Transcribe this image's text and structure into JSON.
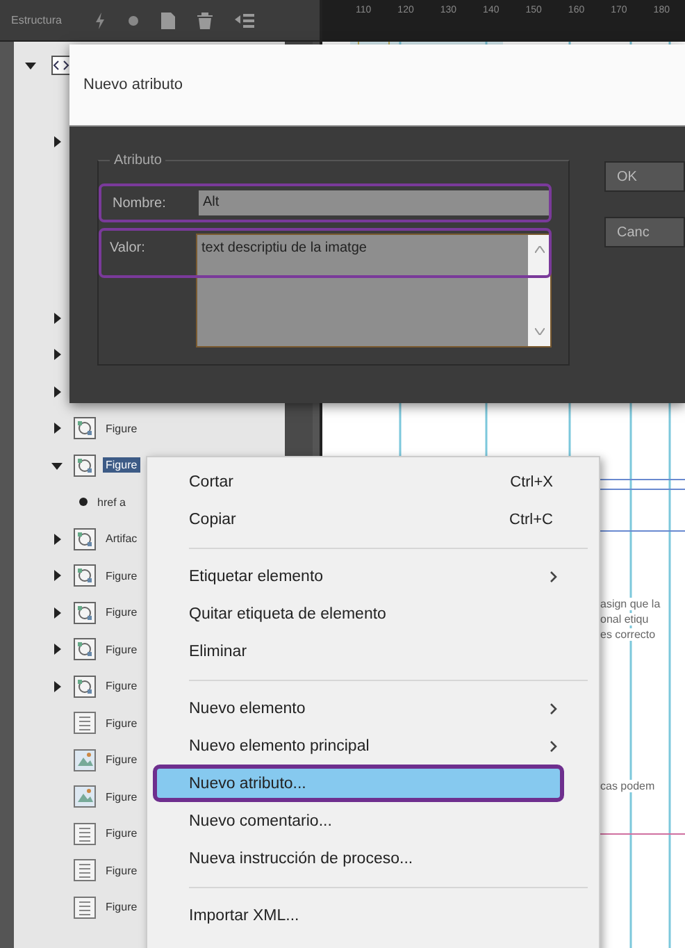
{
  "panel": {
    "title": "Estructura"
  },
  "ruler": {
    "labels": [
      "110",
      "120",
      "130",
      "140",
      "150",
      "160",
      "170",
      "180"
    ]
  },
  "tree_top": [
    {
      "kind": "root",
      "expanded": true,
      "children": [
        {
          "kind": "figure",
          "expanded": false
        }
      ]
    }
  ],
  "tree": [
    {
      "kind": "figure",
      "expanded": false
    },
    {
      "kind": "figure",
      "expanded": false
    },
    {
      "kind": "figure",
      "expanded": false
    },
    {
      "kind": "figure",
      "expanded": false,
      "selected": false,
      "label": "Figure"
    },
    {
      "kind": "figure",
      "expanded": true,
      "selected": true,
      "label": "Figure",
      "children": [
        {
          "kind": "attribute",
          "selected": false,
          "label": "href a"
        }
      ]
    },
    {
      "kind": "figure",
      "expanded": false,
      "selected": false,
      "label": "Artifac"
    },
    {
      "kind": "figure",
      "expanded": false,
      "selected": false,
      "label": "Figure"
    },
    {
      "kind": "figure",
      "expanded": false,
      "selected": false,
      "label": "Figure"
    },
    {
      "kind": "figure",
      "expanded": false,
      "selected": false,
      "label": "Figure"
    },
    {
      "kind": "figure",
      "expanded": false,
      "selected": false,
      "label": "Figure"
    },
    {
      "kind": "text",
      "selected": false,
      "label": "Figure"
    },
    {
      "kind": "graphic",
      "selected": false,
      "label": "Figure"
    },
    {
      "kind": "graphic",
      "selected": false,
      "label": "Figure"
    },
    {
      "kind": "text",
      "selected": false,
      "label": "Figure"
    },
    {
      "kind": "text",
      "selected": false,
      "label": "Figure"
    },
    {
      "kind": "text",
      "selected": false,
      "label": "Figure"
    }
  ],
  "document": {
    "lines": [
      "asign que la",
      "onal etiqu",
      "es correcto"
    ],
    "line_2": "cas podem"
  },
  "dialog": {
    "title": "Nuevo atributo",
    "group": "Atributo",
    "name_label": "Nombre:",
    "name_value": "Alt",
    "value_label": "Valor:",
    "value_value": "text descriptiu de la imatge",
    "buttons": [
      "OK",
      "Canc"
    ]
  },
  "menu": {
    "items": [
      {
        "kind": "item",
        "label": "Cortar",
        "shortcut": "Ctrl+X",
        "submenu": false,
        "selected": false
      },
      {
        "kind": "item",
        "label": "Copiar",
        "shortcut": "Ctrl+C",
        "submenu": false,
        "selected": false
      },
      {
        "kind": "separator"
      },
      {
        "kind": "item",
        "label": "Etiquetar elemento",
        "submenu": true,
        "selected": false
      },
      {
        "kind": "item",
        "label": "Quitar etiqueta de elemento",
        "submenu": false,
        "selected": false
      },
      {
        "kind": "item",
        "label": "Eliminar",
        "submenu": false,
        "selected": false
      },
      {
        "kind": "separator"
      },
      {
        "kind": "item",
        "label": "Nuevo elemento",
        "submenu": true,
        "selected": false
      },
      {
        "kind": "item",
        "label": "Nuevo elemento principal",
        "submenu": true,
        "selected": false
      },
      {
        "kind": "item",
        "label": "Nuevo atributo...",
        "submenu": false,
        "selected": true
      },
      {
        "kind": "item",
        "label": "Nuevo comentario...",
        "submenu": false,
        "selected": false
      },
      {
        "kind": "item",
        "label": "Nueva instrucción de proceso...",
        "submenu": false,
        "selected": false
      },
      {
        "kind": "separator"
      },
      {
        "kind": "item",
        "label": "Importar XML...",
        "submenu": false,
        "selected": false
      }
    ]
  }
}
